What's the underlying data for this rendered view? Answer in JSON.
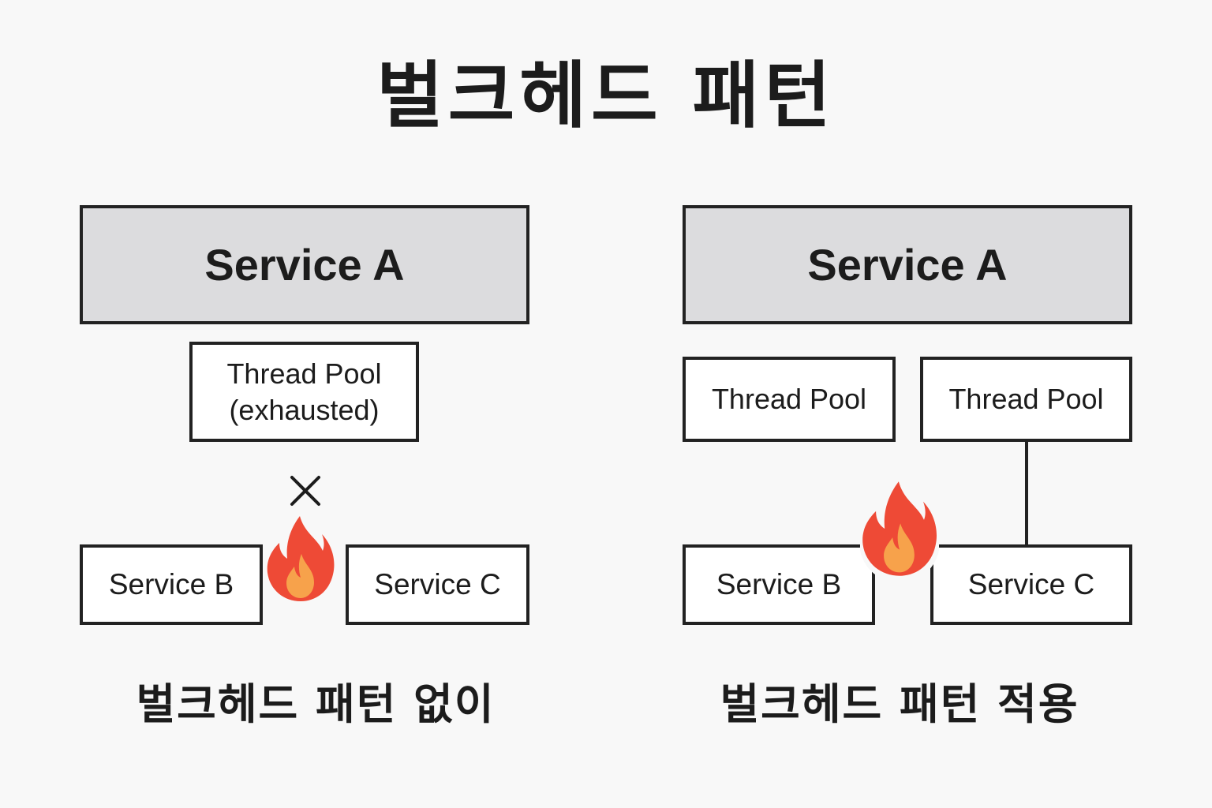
{
  "title": "벌크헤드 패턴",
  "left": {
    "service_a": "Service A",
    "pool_line1": "Thread Pool",
    "pool_line2": "(exhausted)",
    "service_b": "Service B",
    "service_c": "Service C",
    "caption": "벌크헤드 패턴 없이"
  },
  "right": {
    "service_a": "Service A",
    "pool_1": "Thread Pool",
    "pool_2": "Thread Pool",
    "service_b": "Service B",
    "service_c": "Service C",
    "caption": "벌크헤드 패턴 적용"
  },
  "icons": {
    "failure": "x-icon",
    "overload": "fire-icon"
  },
  "colors": {
    "service_a_fill": "#dcdcde",
    "fire_outer": "#ee4a36",
    "fire_inner": "#f7a24b"
  }
}
